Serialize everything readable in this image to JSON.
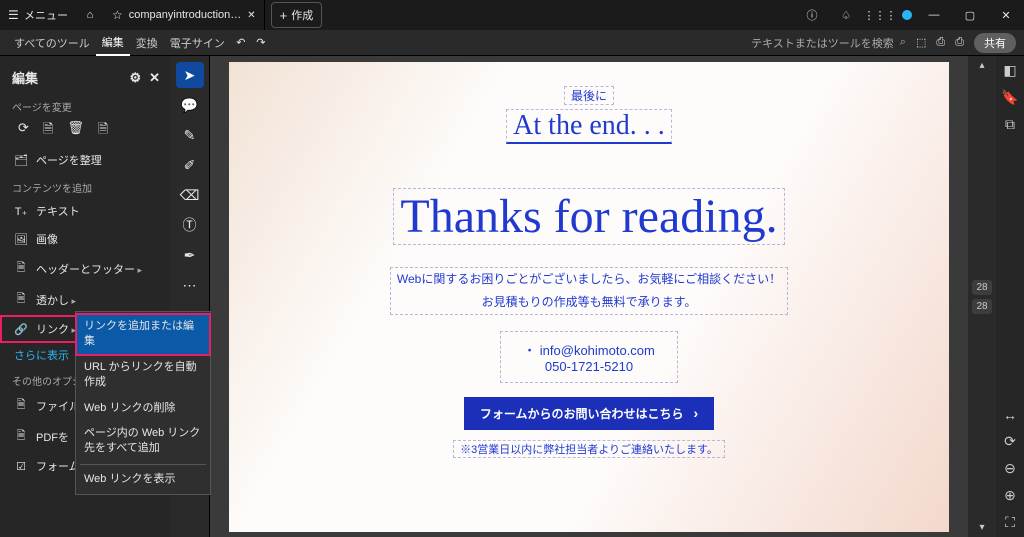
{
  "titlebar": {
    "menu": "メニュー",
    "tab_title": "companyintroduction…",
    "new_tab": "作成"
  },
  "toolbar": {
    "all_tools": "すべてのツール",
    "edit": "編集",
    "convert": "変換",
    "esign": "電子サイン",
    "search_placeholder": "テキストまたはツールを検索",
    "share": "共有"
  },
  "left_panel": {
    "title": "編集",
    "section_page": "ページを変更",
    "organize_pages": "ページを整理",
    "section_content": "コンテンツを追加",
    "items": {
      "text": "テキスト",
      "image": "画像",
      "header_footer": "ヘッダーとフッター",
      "watermark": "透かし",
      "link": "リンク"
    },
    "more": "さらに表示",
    "other_options": "その他のオプション",
    "file": "ファイル",
    "pdf": "PDFを",
    "form": "フォーム"
  },
  "context_menu": {
    "add_edit": "リンクを追加または編集",
    "auto_url": "URL からリンクを自動作成",
    "delete_web": "Web リンクの削除",
    "add_all_web": "ページ内の Web リンク先をすべて追加",
    "show_web": "Web リンクを表示"
  },
  "document": {
    "jp_last": "最後に",
    "en_last": "At the end. . .",
    "thanks": "Thanks for reading.",
    "desc_line1": "Webに関するお困りごとがございましたら、お気軽にご相談ください！",
    "desc_line2": "お見積もりの作成等も無料で承ります。",
    "bullet": "・",
    "email": "info@kohimoto.com",
    "phone": "050-1721-5210",
    "cta": "フォームからのお問い合わせはこちら",
    "note": "※3営業日以内に弊社担当者よりご連絡いたします。"
  },
  "pages": {
    "current": "28",
    "total": "28"
  }
}
